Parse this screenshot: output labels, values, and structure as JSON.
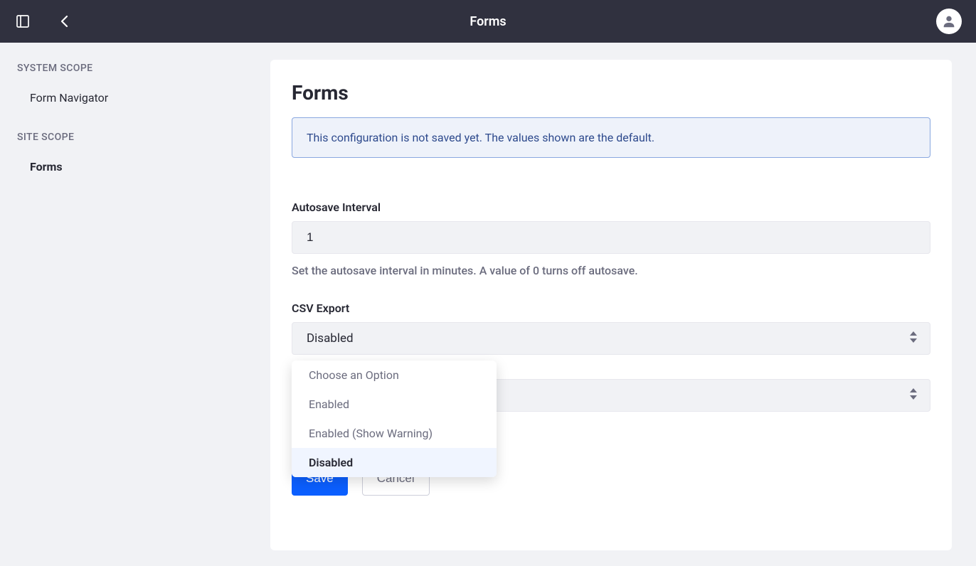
{
  "header": {
    "title": "Forms"
  },
  "sidebar": {
    "system_scope_label": "SYSTEM SCOPE",
    "site_scope_label": "SITE SCOPE",
    "items": {
      "form_navigator": "Form Navigator",
      "forms": "Forms"
    }
  },
  "panel": {
    "title": "Forms",
    "alert_text": "This configuration is not saved yet. The values shown are the default."
  },
  "fields": {
    "autosave": {
      "label": "Autosave Interval",
      "value": "1",
      "help": "Set the autosave interval in minutes. A value of 0 turns off autosave."
    },
    "csv_export": {
      "label": "CSV Export",
      "selected": "Disabled",
      "options": {
        "choose": "Choose an Option",
        "enabled": "Enabled",
        "enabled_warn": "Enabled (Show Warning)",
        "disabled": "Disabled"
      }
    }
  },
  "buttons": {
    "save": "Save",
    "cancel": "Cancel"
  }
}
